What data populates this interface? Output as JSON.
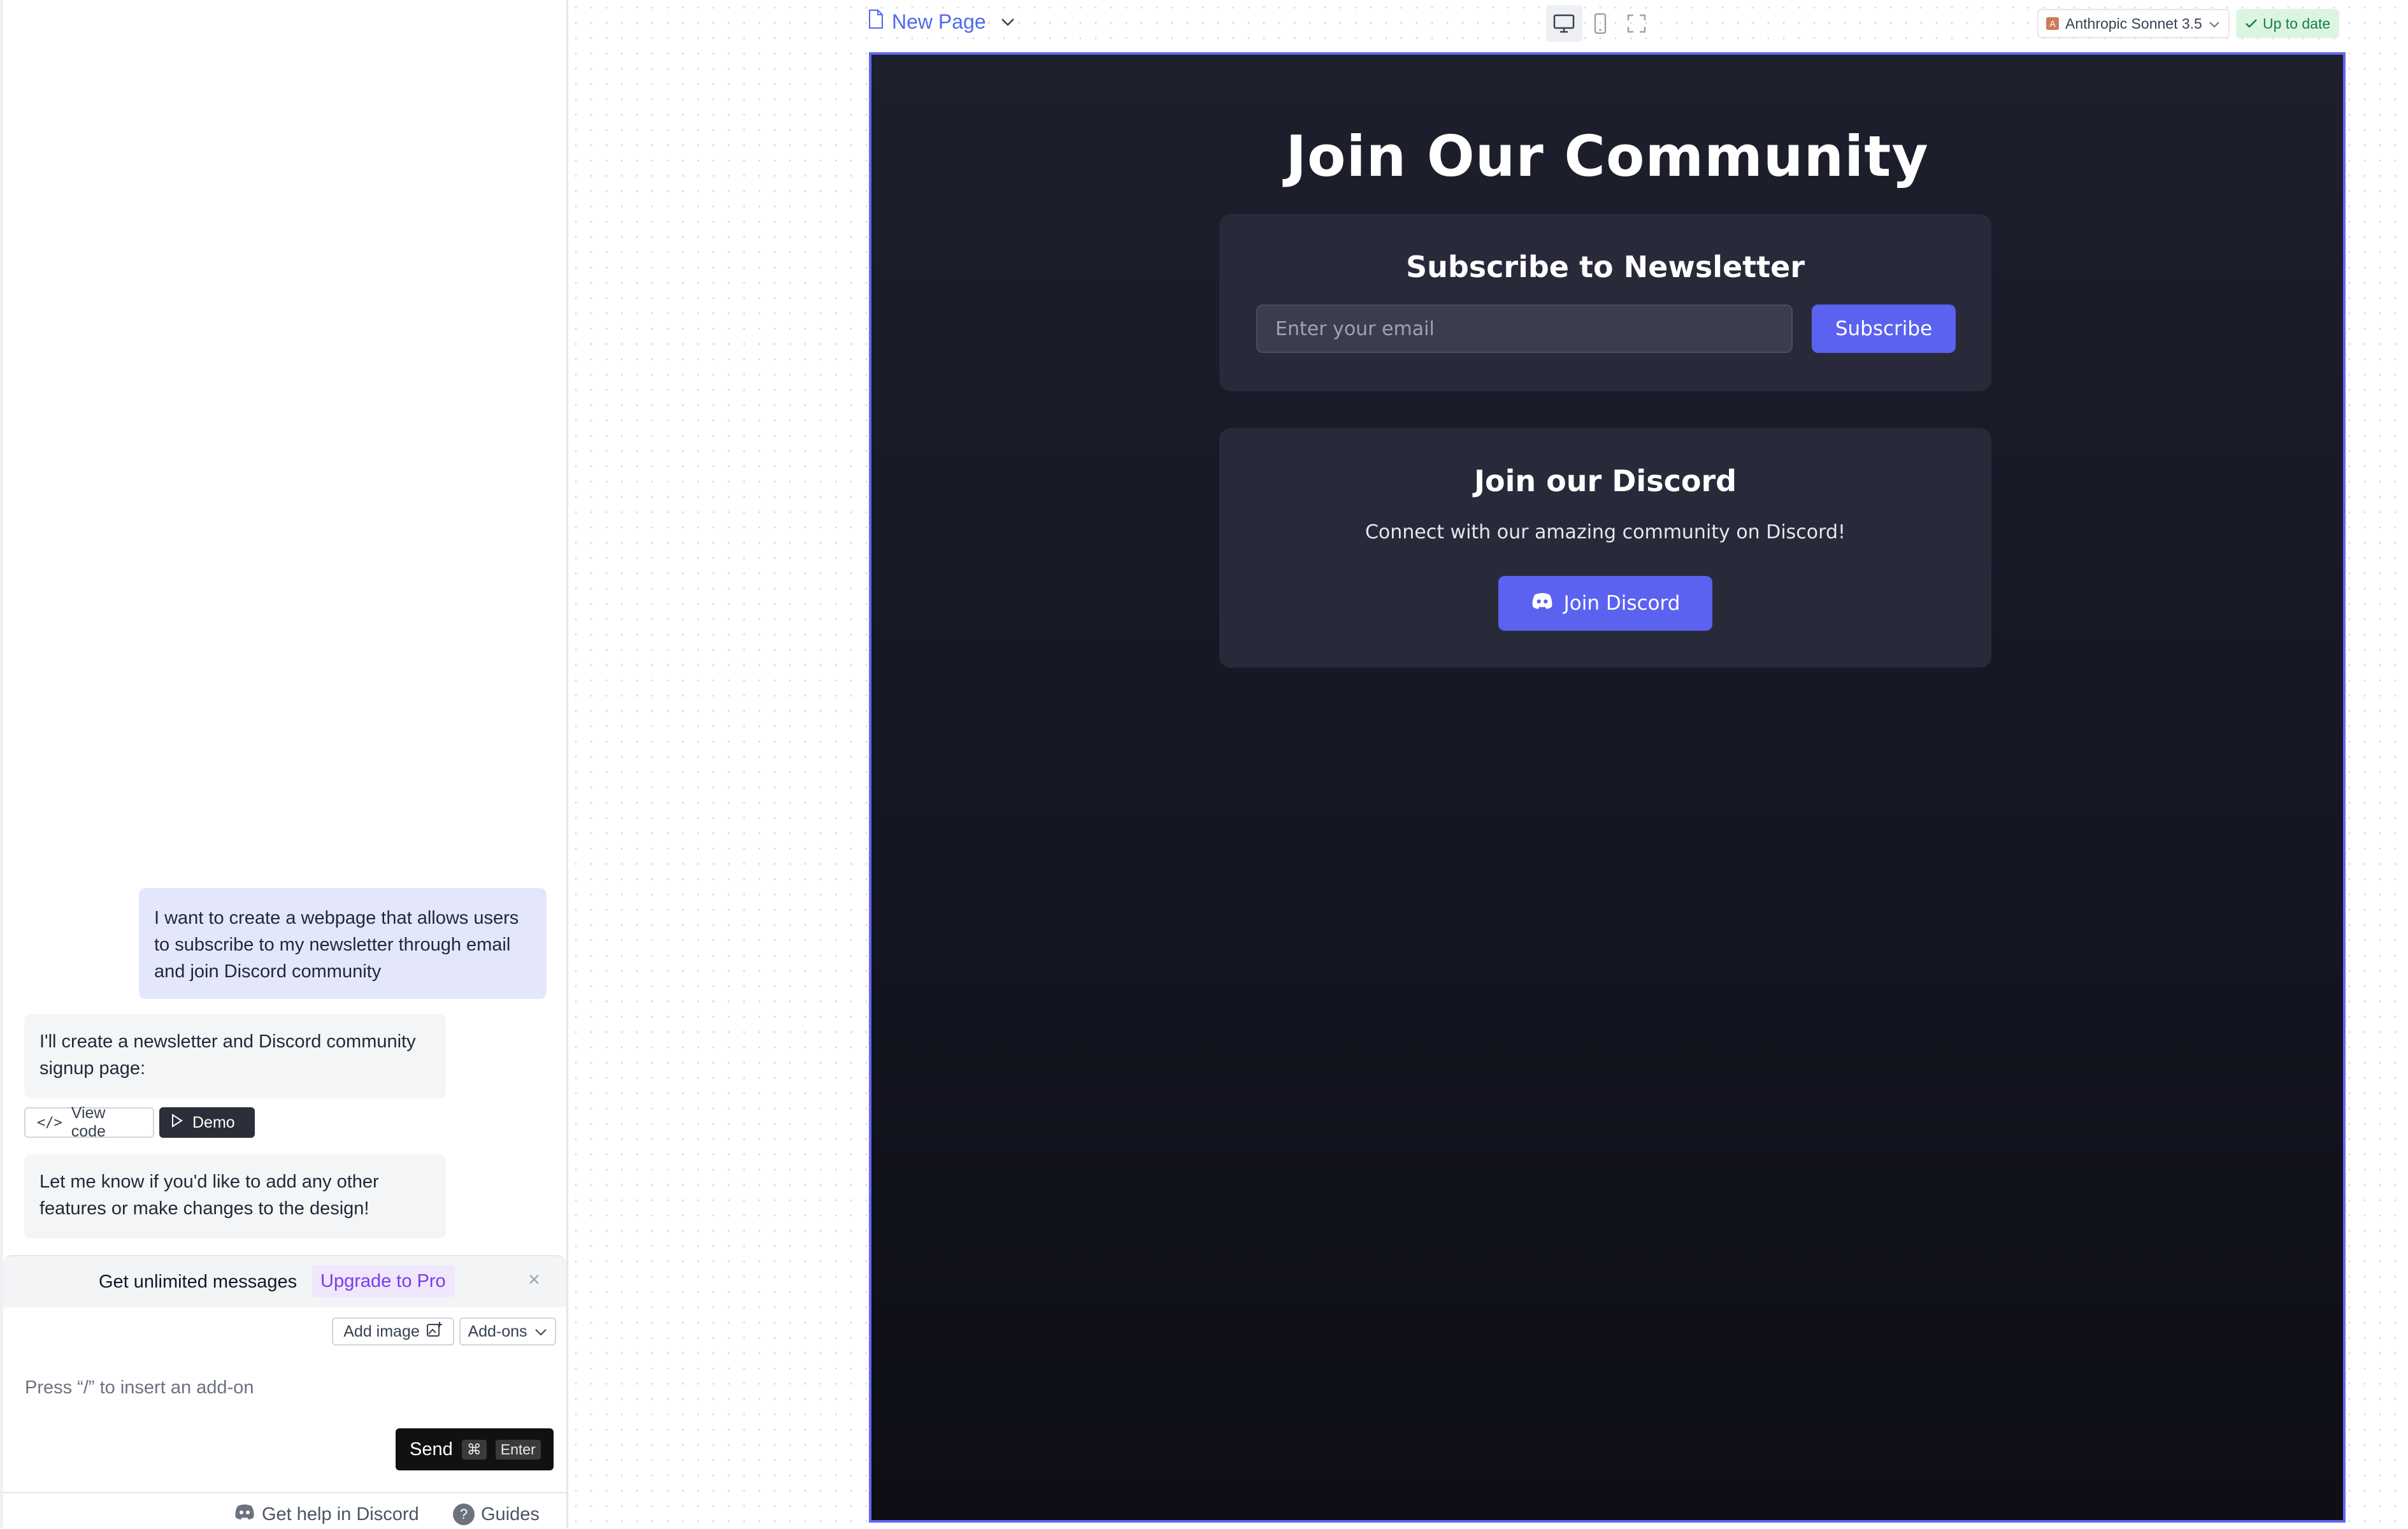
{
  "chat": {
    "messages": {
      "user_1": "I want to create a webpage that allows users to subscribe to my newsletter through email and join Discord community",
      "bot_1": "I'll create a newsletter and Discord community signup page:",
      "bot_2": "Let me know if you'd like to add any other features or make changes to the design!"
    },
    "actions": {
      "view_code": "View code",
      "demo": "Demo"
    },
    "upgrade": {
      "text": "Get unlimited messages",
      "link": "Upgrade to Pro",
      "close": "×"
    },
    "composer": {
      "add_image": "Add image",
      "addons": "Add-ons",
      "placeholder": "Press “/” to insert an add-on",
      "send": "Send",
      "shortcut_cmd": "⌘",
      "shortcut_enter": "Enter"
    },
    "footer": {
      "discord_help": "Get help in Discord",
      "guides": "Guides"
    }
  },
  "toolbar": {
    "page_name": "New Page",
    "model": "Anthropic Sonnet 3.5",
    "status": "Up to date",
    "views": [
      "desktop-view",
      "mobile-view",
      "fullscreen"
    ]
  },
  "preview": {
    "title": "Join Our Community",
    "newsletter": {
      "title": "Subscribe to Newsletter",
      "email_placeholder": "Enter your email",
      "button": "Subscribe"
    },
    "discord": {
      "title": "Join our Discord",
      "description": "Connect with our amazing community on Discord!",
      "button": "Join Discord"
    }
  },
  "colors": {
    "accent": "#6366f1",
    "button": "#5b62f0",
    "card": "#282a3a",
    "page_bg_top": "#1d1f2c",
    "page_bg_bottom": "#0d0e16",
    "status_bg": "#dcf5e3",
    "status_text": "#15803d",
    "upgrade_link": "#7c3aed"
  }
}
